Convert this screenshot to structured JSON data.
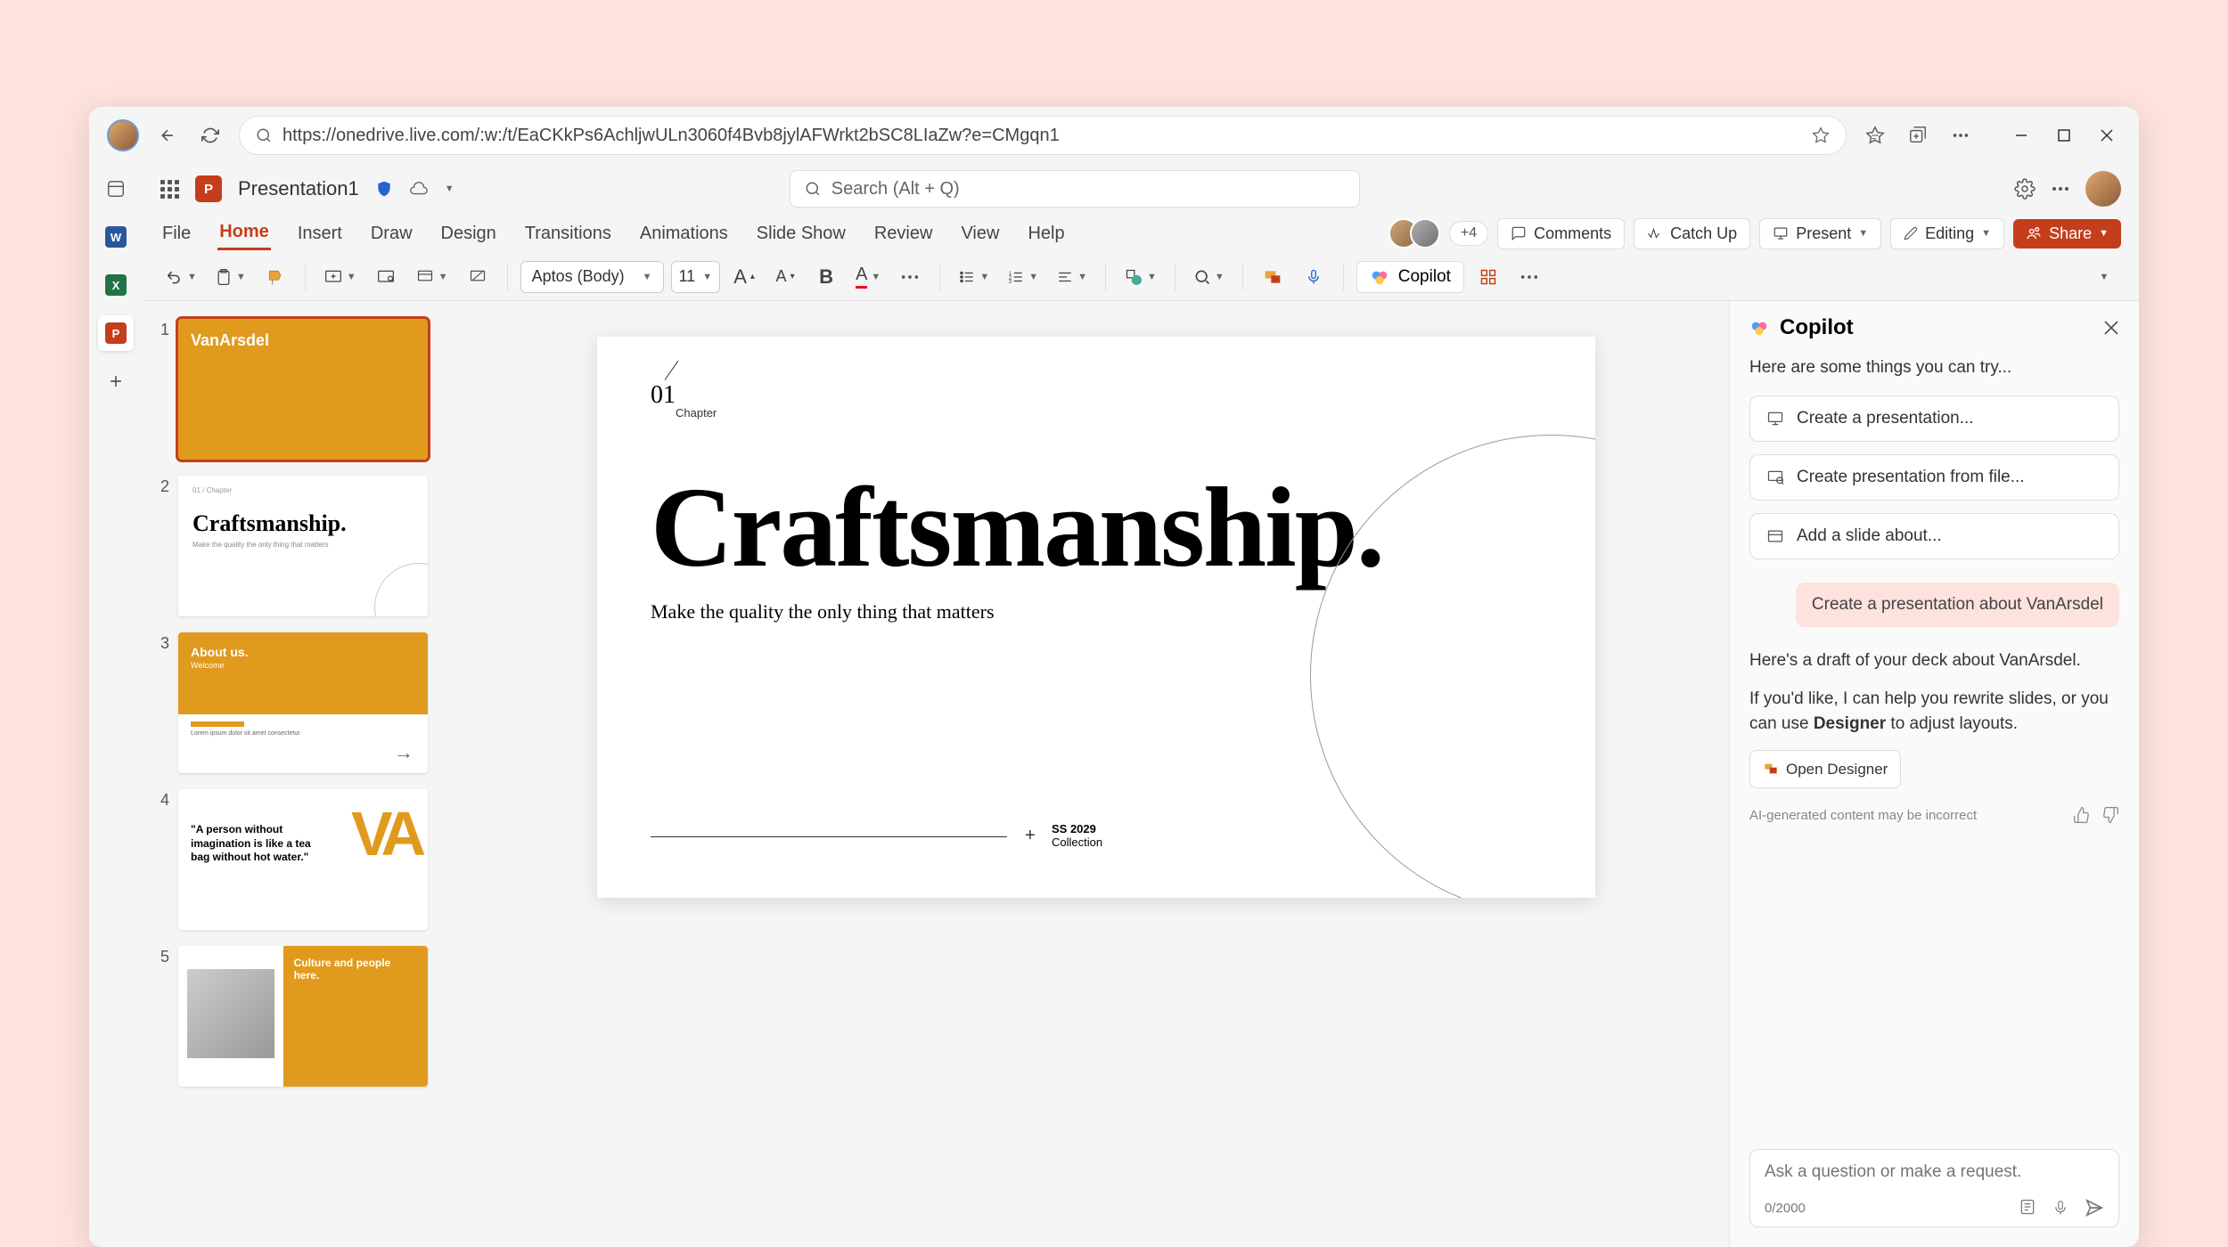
{
  "browser": {
    "url": "https://onedrive.live.com/:w:/t/EaCKkPs6AchljwULn3060f4Bvb8jylAFWrkt2bSC8LIaZw?e=CMgqn1"
  },
  "titlebar": {
    "doc_name": "Presentation1",
    "search_placeholder": "Search (Alt + Q)"
  },
  "menu": {
    "items": [
      "File",
      "Home",
      "Insert",
      "Draw",
      "Design",
      "Transitions",
      "Animations",
      "Slide Show",
      "Review",
      "View",
      "Help"
    ],
    "active": "Home",
    "extra_count": "+4",
    "comments": "Comments",
    "catchup": "Catch Up",
    "present": "Present",
    "editing": "Editing",
    "share": "Share"
  },
  "ribbon": {
    "font_name": "Aptos (Body)",
    "font_size": "11",
    "copilot": "Copilot"
  },
  "thumbs": [
    {
      "num": "1",
      "brand": "VanArsdel"
    },
    {
      "num": "2",
      "title": "Craftsmanship.",
      "sub": "Make the quality the only thing that matters"
    },
    {
      "num": "3",
      "title": "About us.",
      "sub": "Welcome"
    },
    {
      "num": "4",
      "quote": "\"A person without imagination is like a tea bag without hot water.\""
    },
    {
      "num": "5",
      "title": "Culture and people here."
    }
  ],
  "slide": {
    "chapter_num": "01",
    "chapter_label": "Chapter",
    "title": "Craftsmanship.",
    "subtitle": "Make the quality the only thing that matters",
    "footer_year": "SS 2029",
    "footer_collection": "Collection"
  },
  "copilot": {
    "title": "Copilot",
    "intro": "Here are some things you can try...",
    "suggestions": [
      "Create a presentation...",
      "Create presentation from file...",
      "Add a slide about..."
    ],
    "user_message": "Create a presentation about VanArsdel",
    "response_1": "Here's a draft of your deck about VanArsdel.",
    "response_2a": "If you'd like, I can help you rewrite slides, or you can use ",
    "response_2b": "Designer",
    "response_2c": " to adjust layouts.",
    "open_designer": "Open Designer",
    "disclaimer": "AI-generated content may be incorrect",
    "input_placeholder": "Ask a question or make a request.",
    "char_count": "0/2000"
  }
}
